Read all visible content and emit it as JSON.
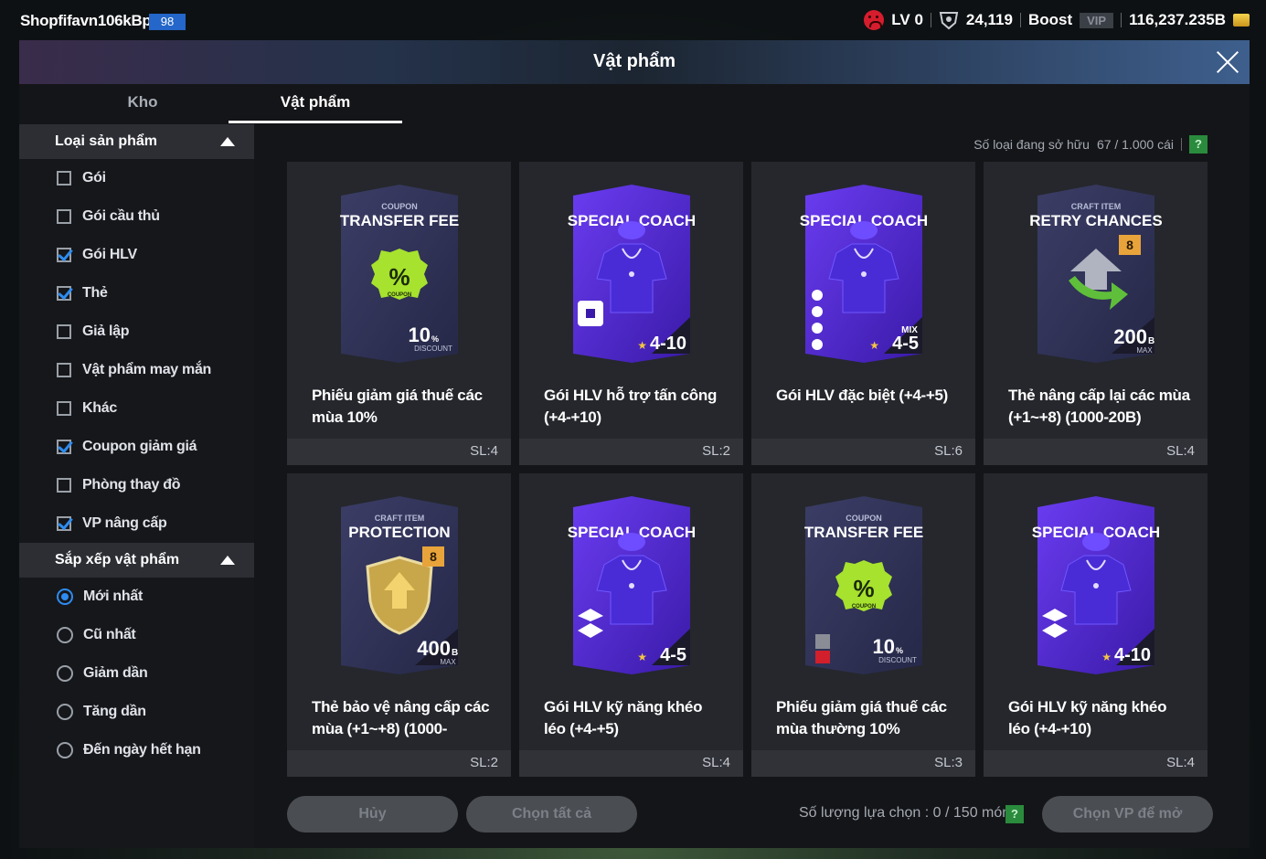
{
  "topbar": {
    "username": "Shopfifavn106kBp",
    "user_level": "98",
    "lv_label": "LV 0",
    "points": "24,119",
    "boost_label": "Boost",
    "vip_label": "VIP",
    "balance": "116,237.235B"
  },
  "header": {
    "title": "Vật phẩm"
  },
  "tabs": [
    {
      "label": "Kho"
    },
    {
      "label": "Vật phẩm",
      "active": true
    }
  ],
  "sidebar": {
    "category_title": "Loại sản phẩm",
    "categories": [
      {
        "label": "Gói",
        "checked": false
      },
      {
        "label": "Gói cầu thủ",
        "checked": false
      },
      {
        "label": "Gói HLV",
        "checked": true
      },
      {
        "label": "Thẻ",
        "checked": true
      },
      {
        "label": "Giả lập",
        "checked": false
      },
      {
        "label": "Vật phẩm may mắn",
        "checked": false
      },
      {
        "label": "Khác",
        "checked": false
      },
      {
        "label": "Coupon giảm giá",
        "checked": true
      },
      {
        "label": "Phòng thay đồ",
        "checked": false
      },
      {
        "label": "VP nâng cấp",
        "checked": true
      }
    ],
    "sort_title": "Sắp xếp vật phẩm",
    "sorts": [
      {
        "label": "Mới nhất",
        "selected": true
      },
      {
        "label": "Cũ nhất",
        "selected": false
      },
      {
        "label": "Giảm dần",
        "selected": false
      },
      {
        "label": "Tăng dần",
        "selected": false
      },
      {
        "label": "Đến ngày hết hạn",
        "selected": false
      }
    ]
  },
  "owned": {
    "label": "Số loại đang sở hữu",
    "value": "67 / 1.000 cái",
    "help": "?"
  },
  "items": [
    {
      "kind": "coupon",
      "art_small": "COUPON",
      "art_title": "TRANSFER FEE",
      "art_value": "10",
      "art_unit": "%",
      "art_sub": "DISCOUNT",
      "badge": "COUPON",
      "name": "Phiếu giảm giá thuế các mùa 10%",
      "qty": "SL:4"
    },
    {
      "kind": "coach",
      "art_title": "SPECIAL COACH",
      "art_range": "4-10",
      "name": "Gói HLV hỗ trợ tấn công (+4-+10)",
      "qty": "SL:2"
    },
    {
      "kind": "coach-mix",
      "art_title": "SPECIAL COACH",
      "art_mix": "MIX",
      "art_range": "4-5",
      "name": "Gói HLV đặc biệt (+4-+5)",
      "qty": "SL:6"
    },
    {
      "kind": "retry",
      "art_small": "CRAFT ITEM",
      "art_title": "RETRY CHANCES",
      "art_value": "200",
      "art_unit": "B",
      "art_sub": "MAX",
      "art_badge_num": "8",
      "name": "Thẻ nâng cấp lại các mùa (+1~+8) (1000-20B)",
      "qty": "SL:4"
    },
    {
      "kind": "protect",
      "art_small": "CRAFT ITEM",
      "art_title": "PROTECTION",
      "art_value": "400",
      "art_unit": "B",
      "art_sub": "MAX",
      "art_badge_num": "8",
      "name": "Thẻ bảo vệ nâng cấp các mùa (+1~+8) (1000-",
      "qty": "SL:2"
    },
    {
      "kind": "coach2",
      "art_title": "SPECIAL COACH",
      "art_range": "4-5",
      "name": "Gói HLV kỹ năng khéo léo (+4-+5)",
      "qty": "SL:4"
    },
    {
      "kind": "coupon2",
      "art_small": "COUPON",
      "art_title": "TRANSFER FEE",
      "art_value": "10",
      "art_unit": "%",
      "art_sub": "DISCOUNT",
      "badge": "COUPON",
      "name": "Phiếu giảm giá thuế các mùa thường 10%",
      "qty": "SL:3"
    },
    {
      "kind": "coach2",
      "art_title": "SPECIAL COACH",
      "art_range": "4-10",
      "name": "Gói HLV kỹ năng khéo léo (+4-+10)",
      "qty": "SL:4"
    }
  ],
  "bottom": {
    "cancel": "Hủy",
    "select_all": "Chọn tất cả",
    "selected_label": "Số lượng lựa chọn : 0 / 150 món",
    "help": "?",
    "open": "Chọn VP để mở"
  },
  "colors": {
    "accent": "#2d8cf0",
    "coupon_green": "#a6e22e",
    "coach_purple": "#5b2ee0",
    "help_green": "#2a8b3d"
  }
}
